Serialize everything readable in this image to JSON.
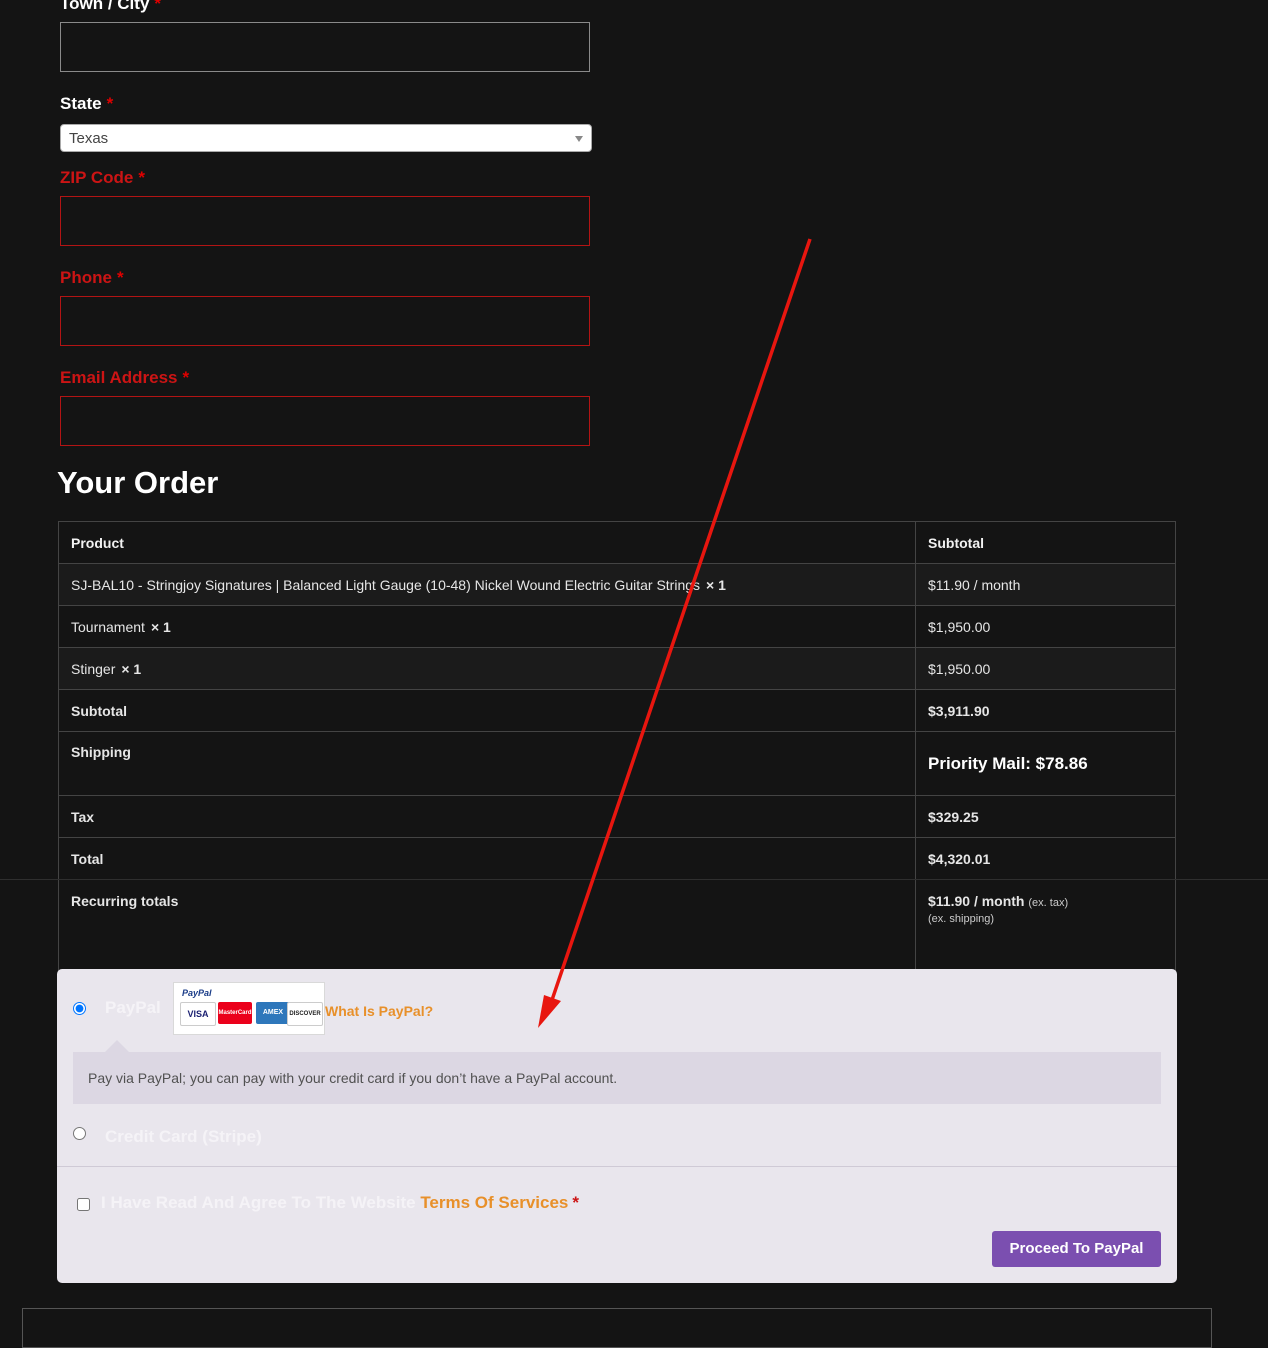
{
  "form": {
    "town_label": "Town / City",
    "state_label": "State",
    "state_value": "Texas",
    "zip_label": "ZIP Code",
    "phone_label": "Phone",
    "email_label": "Email Address",
    "required_mark": "*"
  },
  "order": {
    "title": "Your Order",
    "headers": {
      "product": "Product",
      "subtotal": "Subtotal"
    },
    "items": [
      {
        "name": "SJ-BAL10 - Stringjoy Signatures | Balanced Light Gauge (10-48) Nickel Wound Electric Guitar Strings",
        "qty": "× 1",
        "price": "$11.90 / month"
      },
      {
        "name": "Tournament",
        "qty": "× 1",
        "price": "$1,950.00"
      },
      {
        "name": "Stinger",
        "qty": "× 1",
        "price": "$1,950.00"
      }
    ],
    "subtotal_label": "Subtotal",
    "subtotal_value": "$3,911.90",
    "shipping_label": "Shipping",
    "shipping_value": "Priority Mail: $78.86",
    "tax_label": "Tax",
    "tax_value": "$329.25",
    "total_label": "Total",
    "total_value": "$4,320.01",
    "recurring_label": "Recurring totals",
    "recurring_value": "$11.90 / month",
    "recurring_tax_note": "(ex. tax)",
    "recurring_shipping_note": "(ex. shipping)"
  },
  "payment": {
    "paypal_label": "PayPal",
    "paypal_selected": true,
    "paypal_brand": "PayPal",
    "cards": [
      "VISA",
      "MasterCard",
      "AMEX",
      "DISCOVER"
    ],
    "what_is_paypal": "What Is PayPal?",
    "paypal_description": "Pay via PayPal; you can pay with your credit card if you don’t have a PayPal account.",
    "stripe_label": "Credit Card (Stripe)",
    "terms_prefix": "I Have Read And Agree To The Website",
    "terms_link": "Terms Of Services",
    "terms_required": "*",
    "proceed_button": "Proceed To PayPal"
  },
  "colors": {
    "background": "#141414",
    "error_red": "#cc1414",
    "link_orange": "#e8902a",
    "button_purple": "#7b4fb0",
    "annotation_arrow": "#e8160f"
  }
}
